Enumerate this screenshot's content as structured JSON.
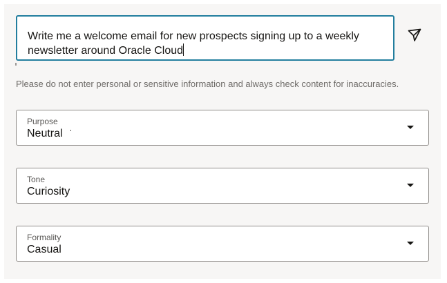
{
  "prompt": {
    "text": "Write me a welcome email for new prospects signing up to a weekly\nnewsletter around Oracle Cloud"
  },
  "send_icon": "send-paper-plane-icon",
  "disclaimer": "Please do not enter personal or sensitive information and always check content for inaccuracies.",
  "fields": {
    "purpose": {
      "label": "Purpose",
      "value": "Neutral"
    },
    "tone": {
      "label": "Tone",
      "value": "Curiosity"
    },
    "formality": {
      "label": "Formality",
      "value": "Casual"
    }
  },
  "colors": {
    "focus_border": "#227e9e",
    "panel_background": "#f7f6f5",
    "text": "#161513",
    "muted_text": "#6f6c69"
  }
}
